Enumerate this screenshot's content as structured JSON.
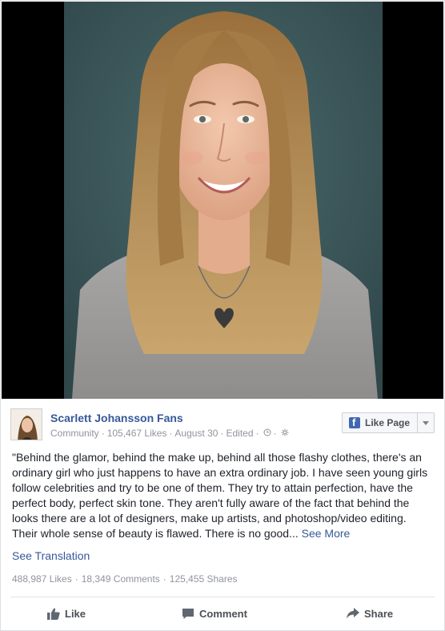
{
  "photo": {
    "subject": "portrait-photo"
  },
  "header": {
    "page_name": "Scarlett Johansson Fans",
    "category": "Community",
    "likes": "105,467 Likes",
    "date": "August 30",
    "edited": "Edited",
    "like_page_label": "Like Page"
  },
  "post": {
    "text": "\"Behind the glamor, behind the make up, behind all those flashy clothes, there's an ordinary girl who just happens to have an extra ordinary job. I have seen young girls follow celebrities and try to be one of them. They try to attain perfection, have the perfect body, perfect skin tone. They aren't fully aware of the fact that behind the looks there are a lot of designers, make up artists, and photoshop/video editing. Their whole sense of beauty is flawed. There is no good...",
    "see_more": "See More",
    "see_translation": "See Translation"
  },
  "stats": {
    "likes": "488,987 Likes",
    "comments": "18,349 Comments",
    "shares": "125,455 Shares"
  },
  "actions": {
    "like": "Like",
    "comment": "Comment",
    "share": "Share"
  },
  "colors": {
    "link": "#365899",
    "meta": "#90949c",
    "brand": "#4267b2"
  }
}
